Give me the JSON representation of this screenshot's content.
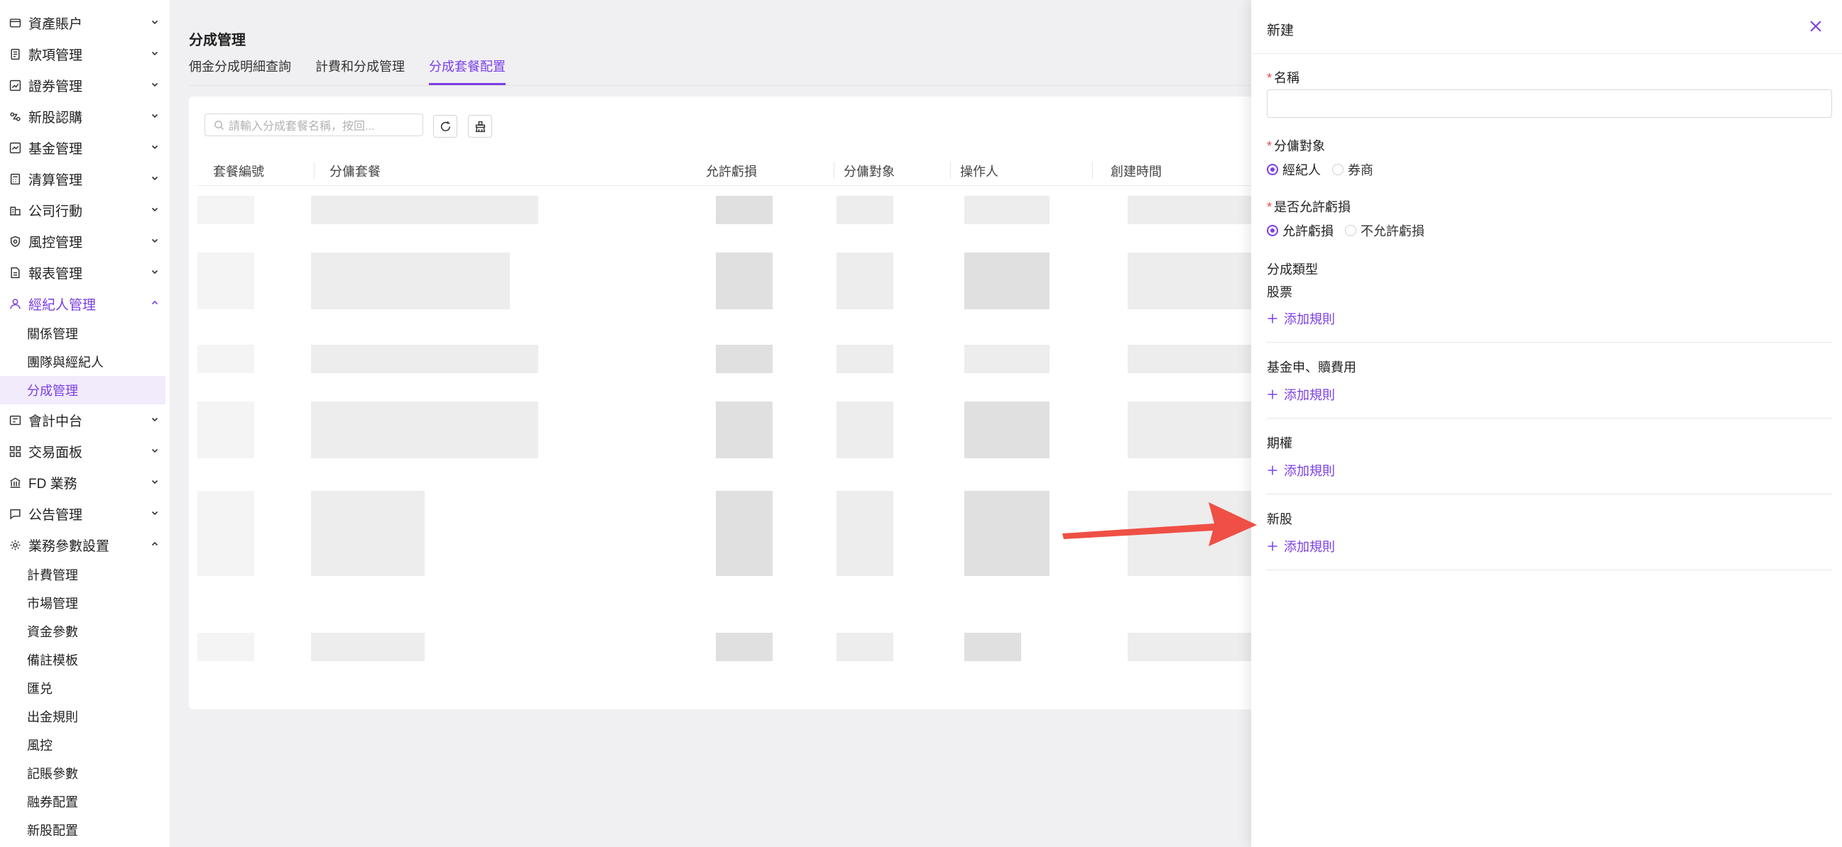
{
  "sidebar": {
    "items": [
      {
        "label": "資產賬户",
        "icon": "wallet-icon"
      },
      {
        "label": "款項管理",
        "icon": "document-icon"
      },
      {
        "label": "證券管理",
        "icon": "chart-icon"
      },
      {
        "label": "新股認購",
        "icon": "ipo-icon"
      },
      {
        "label": "基金管理",
        "icon": "trend-icon"
      },
      {
        "label": "清算管理",
        "icon": "calculator-icon"
      },
      {
        "label": "公司行動",
        "icon": "building-icon"
      },
      {
        "label": "風控管理",
        "icon": "shield-icon"
      },
      {
        "label": "報表管理",
        "icon": "report-icon"
      },
      {
        "label": "經紀人管理",
        "icon": "user-icon"
      },
      {
        "label": "會計中台",
        "icon": "ledger-icon"
      },
      {
        "label": "交易面板",
        "icon": "grid-icon"
      },
      {
        "label": "FD 業務",
        "icon": "bank-icon"
      },
      {
        "label": "公告管理",
        "icon": "message-icon"
      },
      {
        "label": "業務參數設置",
        "icon": "gear-icon"
      }
    ],
    "broker_sub": [
      "關係管理",
      "團隊與經紀人",
      "分成管理"
    ],
    "params_sub": [
      "計費管理",
      "市場管理",
      "資金參數",
      "備註模板",
      "匯兑",
      "出金規則",
      "風控",
      "記賬參數",
      "融券配置",
      "新股配置"
    ]
  },
  "main": {
    "title": "分成管理",
    "tabs": [
      "佣金分成明細查詢",
      "計費和分成管理",
      "分成套餐配置"
    ],
    "search_placeholder": "請輸入分成套餐名稱，按回...",
    "columns": [
      "套餐編號",
      "分傭套餐",
      "允許虧損",
      "分傭對象",
      "操作人",
      "創建時間"
    ]
  },
  "drawer": {
    "title": "新建",
    "name_label": "名稱",
    "target_label": "分傭對象",
    "target_options": [
      "經紀人",
      "券商"
    ],
    "loss_label": "是否允許虧損",
    "loss_options": [
      "允許虧損",
      "不允許虧損"
    ],
    "split_type_label": "分成類型",
    "sections": [
      "股票",
      "基金申、贖費用",
      "期權",
      "新股"
    ],
    "add_rule_label": "添加規則"
  },
  "colors": {
    "accent": "#7b3fe4",
    "required": "#e5484d",
    "arrow": "#ef4f45"
  }
}
